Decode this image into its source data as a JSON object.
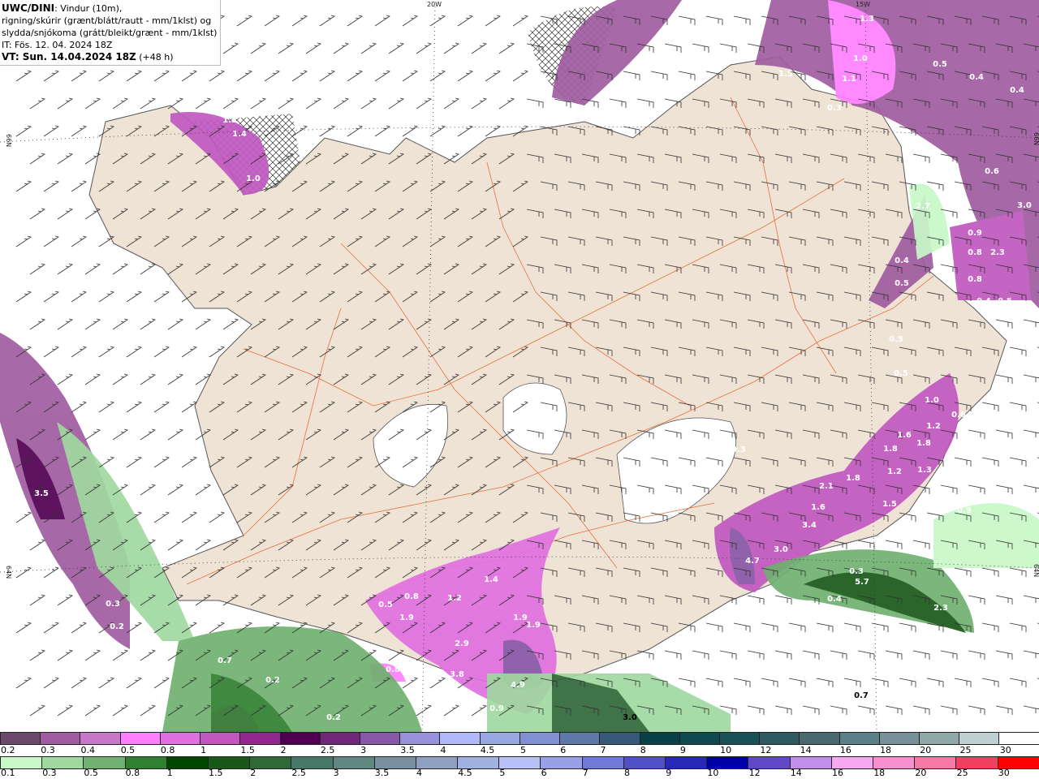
{
  "header": {
    "model": "UWC/DINI",
    "title_rest": ": Vindur (10m),",
    "line2": "rigning/skúrir (grænt/blátt/rautt - mm/1klst) og",
    "line3": "slydda/snjókoma (grátt/bleikt/grænt - mm/1klst)",
    "issue_time": "IT: Fös. 12. 04. 2024 18Z",
    "valid_label": "VT: Sun. 14.04.2024 18Z",
    "lead": " (+48 h)"
  },
  "grid_labels": {
    "lon_20w": "20W",
    "lon_15w": "15W",
    "lat_66n": "66N",
    "lat_64n": "64N"
  },
  "colors": {
    "sea": "#ffffff",
    "land": "#efe3d6",
    "roads": "#e8703a",
    "coast": "#555555"
  },
  "map_values": [
    "1.3",
    "1.0",
    "1.5",
    "1.1",
    "0.3",
    "0.5",
    "0.4",
    "0.4",
    "1.3",
    "1.4",
    "1.0",
    "0.6",
    "3.0",
    "2.7",
    "0.9",
    "0.8",
    "2.3",
    "0.4",
    "0.8",
    "0.5",
    "0.4",
    "0.5",
    "0.5",
    "0.5",
    "1.0",
    "0.6",
    "1.6",
    "1.2",
    "1.8",
    "1.8",
    "0.3",
    "1.2",
    "1.3",
    "1.8",
    "2.1",
    "1.5",
    "0.9",
    "1.6",
    "3.4",
    "3.0",
    "4.7",
    "0.3",
    "5.7",
    "0.4",
    "2.3",
    "0.7",
    "3.5",
    "0.3",
    "0.2",
    "0.3",
    "0.7",
    "0.2",
    "0.2",
    "1.4",
    "1.2",
    "0.5",
    "0.8",
    "1.9",
    "1.9",
    "1.9",
    "2.9",
    "0.8",
    "3.8",
    "4.9",
    "0.7",
    "3.0",
    "1.3",
    "0.9"
  ],
  "legend_snow": {
    "labels": [
      "0.2",
      "0.3",
      "0.4",
      "0.5",
      "0.8",
      "1",
      "1.5",
      "2",
      "2.5",
      "3",
      "3.5",
      "4",
      "4.5",
      "5",
      "6",
      "7",
      "8",
      "9",
      "10",
      "12",
      "14",
      "16",
      "18",
      "20",
      "25",
      "30"
    ],
    "colors": [
      "#6b4a6b",
      "#a05ca0",
      "#c878c8",
      "#ff80ff",
      "#e070e0",
      "#c058c0",
      "#902890",
      "#500050",
      "#702878",
      "#8858a8",
      "#9890d8",
      "#b0b8f8",
      "#98a8e0",
      "#8090d0",
      "#6078a8",
      "#385878",
      "#0a4048",
      "#104850",
      "#1a5058",
      "#305860",
      "#4a6870",
      "#5a8088",
      "#789098",
      "#90a8a8",
      "#c0d0d0",
      "#ffffff"
    ]
  },
  "legend_rain": {
    "labels": [
      "0.1",
      "0.3",
      "0.5",
      "0.8",
      "1",
      "1.5",
      "2",
      "2.5",
      "3",
      "3.5",
      "4",
      "4.5",
      "5",
      "6",
      "7",
      "8",
      "9",
      "10",
      "12",
      "14",
      "16",
      "18",
      "20",
      "25",
      "30"
    ],
    "colors": [
      "#c8f8c8",
      "#a0d8a0",
      "#70b070",
      "#308030",
      "#004800",
      "#185818",
      "#306838",
      "#487868",
      "#608880",
      "#7890a0",
      "#90a0c0",
      "#a0b0e0",
      "#b8c0f8",
      "#98a0e8",
      "#7078d8",
      "#5050c8",
      "#2828b8",
      "#0000a8",
      "#6048c8",
      "#c090e8",
      "#f8a8f0",
      "#f890d0",
      "#f878a8",
      "#f04060",
      "#ff0000"
    ]
  }
}
